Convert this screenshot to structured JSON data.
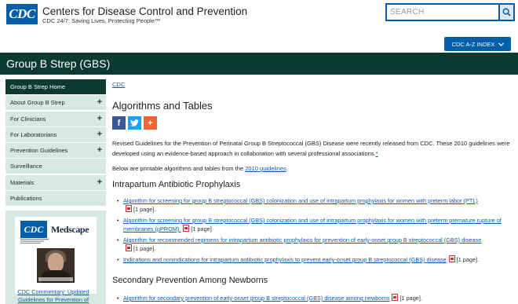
{
  "header": {
    "logo_text": "CDC",
    "agency": "Centers for Disease Control and Prevention",
    "tagline": "CDC 24/7: Saving Lives, Protecting People™",
    "search_placeholder": "SEARCH",
    "az_index_label": "CDC A-Z INDEX"
  },
  "page_title": "Group B Strep (GBS)",
  "sidebar": {
    "items": [
      {
        "label": "Group B Strep Home",
        "active": true,
        "expandable": false
      },
      {
        "label": "About Group B Strep",
        "active": false,
        "expandable": true
      },
      {
        "label": "For Clinicians",
        "active": false,
        "expandable": true
      },
      {
        "label": "For Laboratorians",
        "active": false,
        "expandable": true
      },
      {
        "label": "Prevention Guidelines",
        "active": false,
        "expandable": true
      },
      {
        "label": "Surveillance",
        "active": false,
        "expandable": false
      },
      {
        "label": "Materials",
        "active": false,
        "expandable": true
      },
      {
        "label": "Publications",
        "active": false,
        "expandable": false
      }
    ],
    "promo": {
      "cdc_logo": "CDC",
      "medscape_logo": "Medscape",
      "link_text": "CDC Commentary: Updated Guidelines for Prevention of"
    }
  },
  "main": {
    "breadcrumb": "CDC",
    "heading": "Algorithms and Tables",
    "intro_text": "Revised Guidelines for the Prevention of Perinatal Group B Streptococcal (GBS) Disease were recently released from CDC. These 2010 guidelines were developed using an evidence-based approach in collaboration with several professional associations.",
    "intro_footnote": "*",
    "below_prefix": "Below are printable algorithms and tables from the ",
    "below_link": "2010 guidelines",
    "below_suffix": ".",
    "sections": [
      {
        "title": "Intrapartum Antibiotic Prophylaxis",
        "items": [
          {
            "link": "Algorithm for screening for group B streptococcal (GBS) colonization and use of intrapartum prophylaxis for women with preterm labor (PTL)",
            "pages": "[1 page]."
          },
          {
            "link": "Algorithm for screening for group B streptococcal (GBS) colonization and use of intrapartum prophylaxis for women with preterm premature rupture of membranes (pPROM).",
            "pages": "[1 page]"
          },
          {
            "link": "Algorithm for recommended regimens for intrapartum antibiotic prophylaxis for prevention of early-onset group B streptococcal (GBS) disease",
            "pages": "[1 page]."
          },
          {
            "link": "Indications and nonindications for intrapartum antibiotic prophylaxis to prevent early-onset group B streptococcal (GBS) disease",
            "pages": "[1 page]."
          }
        ]
      },
      {
        "title": "Secondary Prevention Among Newborns",
        "items": [
          {
            "link": "Algorithm for secondary prevention of early-onset group B streptococcal (GBS) disease among newborns",
            "pages": "[1 page]."
          }
        ]
      }
    ]
  },
  "colors": {
    "cdc_blue": "#005eaa",
    "title_bar": "#0b3b30",
    "nav_bg": "#d7e9e3",
    "link": "#0a5ab0",
    "facebook": "#3b5998",
    "twitter": "#1da1f2",
    "addthis": "#f06535"
  }
}
